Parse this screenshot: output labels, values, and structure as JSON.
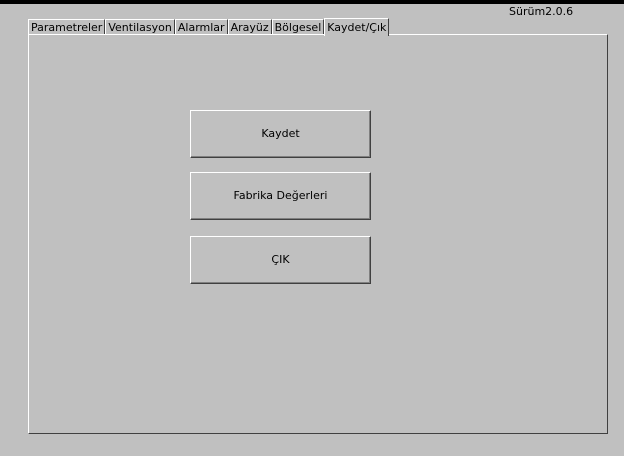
{
  "header": {
    "version": "Sürüm2.0.6"
  },
  "tabs": [
    {
      "label": "Parametreler",
      "active": false
    },
    {
      "label": "Ventilasyon",
      "active": false
    },
    {
      "label": "Alarmlar",
      "active": false
    },
    {
      "label": "Arayüz",
      "active": false
    },
    {
      "label": "Bölgesel",
      "active": false
    },
    {
      "label": "Kaydet/Çık",
      "active": true
    }
  ],
  "panel": {
    "save_label": "Kaydet",
    "factory_label": "Fabrika Değerleri",
    "exit_label": "ÇIK"
  },
  "colors": {
    "background": "#c0c0c0",
    "text": "#000000",
    "highlight": "#ffffff",
    "shadow": "#404040"
  }
}
